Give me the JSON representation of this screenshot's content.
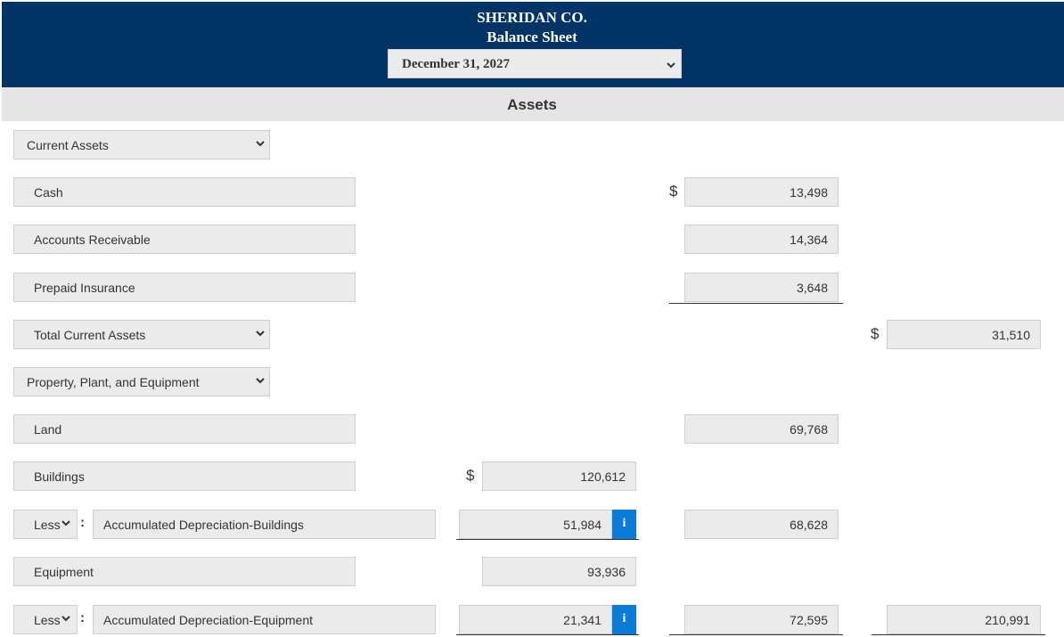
{
  "header": {
    "company": "SHERIDAN CO.",
    "statement": "Balance Sheet",
    "date": "December 31, 2027"
  },
  "section_title": "Assets",
  "currency_symbol": "$",
  "less_label": "Less",
  "rows": {
    "current_assets": {
      "label": "Current Assets"
    },
    "cash": {
      "label": "Cash",
      "value": "13,498"
    },
    "ar": {
      "label": "Accounts Receivable",
      "value": "14,364"
    },
    "prepaid": {
      "label": "Prepaid Insurance",
      "value": "3,648"
    },
    "total_current": {
      "label": "Total Current Assets",
      "value": "31,510"
    },
    "ppe": {
      "label": "Property, Plant, and Equipment"
    },
    "land": {
      "label": "Land",
      "value": "69,768"
    },
    "buildings": {
      "label": "Buildings",
      "value": "120,612"
    },
    "acc_dep_buildings": {
      "label": "Accumulated Depreciation-Buildings",
      "value": "51,984",
      "net": "68,628"
    },
    "equipment": {
      "label": "Equipment",
      "value": "93,936"
    },
    "acc_dep_equipment": {
      "label": "Accumulated Depreciation-Equipment",
      "value": "21,341",
      "net": "72,595",
      "total": "210,991"
    }
  },
  "info_icon_text": "i",
  "colors": {
    "header_bg": "#003366",
    "info_button": "#0a7cd8",
    "field_bg": "#ebebeb"
  }
}
